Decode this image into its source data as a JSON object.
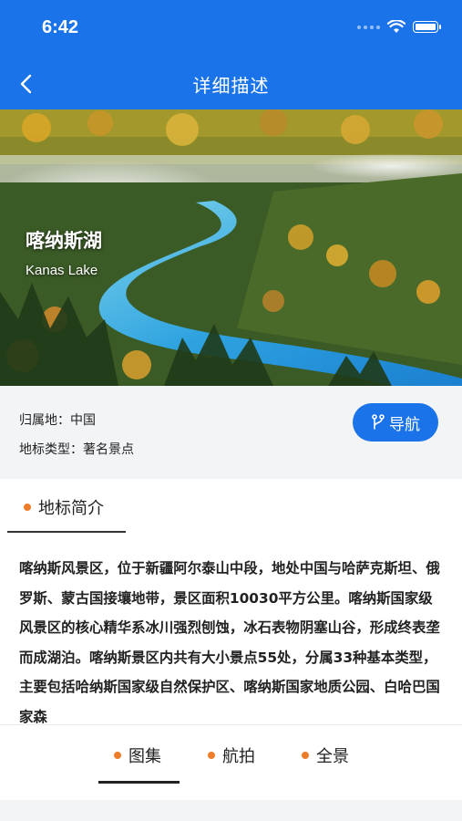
{
  "status": {
    "time": "6:42"
  },
  "header": {
    "title": "详细描述"
  },
  "hero": {
    "name_cn": "喀纳斯湖",
    "name_en": "Kanas Lake"
  },
  "info": {
    "region_label": "归属地：",
    "region_value": "中国",
    "type_label": "地标类型：",
    "type_value": "著名景点",
    "nav_button": "导航"
  },
  "intro": {
    "heading": "地标简介",
    "text": "喀纳斯风景区，位于新疆阿尔泰山中段，地处中国与哈萨克斯坦、俄罗斯、蒙古国接壤地带，景区面积10030平方公里。喀纳斯国家级风景区的核心精华系冰川强烈刨蚀，冰石表物阴塞山谷，形成终表垄而成湖泊。喀纳斯景区内共有大小景点55处，分属33种基本类型，主要包括哈纳斯国家级自然保护区、喀纳斯国家地质公园、白哈巴国家森"
  },
  "tabs": [
    {
      "label": "图集"
    },
    {
      "label": "航拍"
    },
    {
      "label": "全景"
    }
  ],
  "colors": {
    "primary": "#1a73e8",
    "accent_dot": "#ee7d2a"
  }
}
